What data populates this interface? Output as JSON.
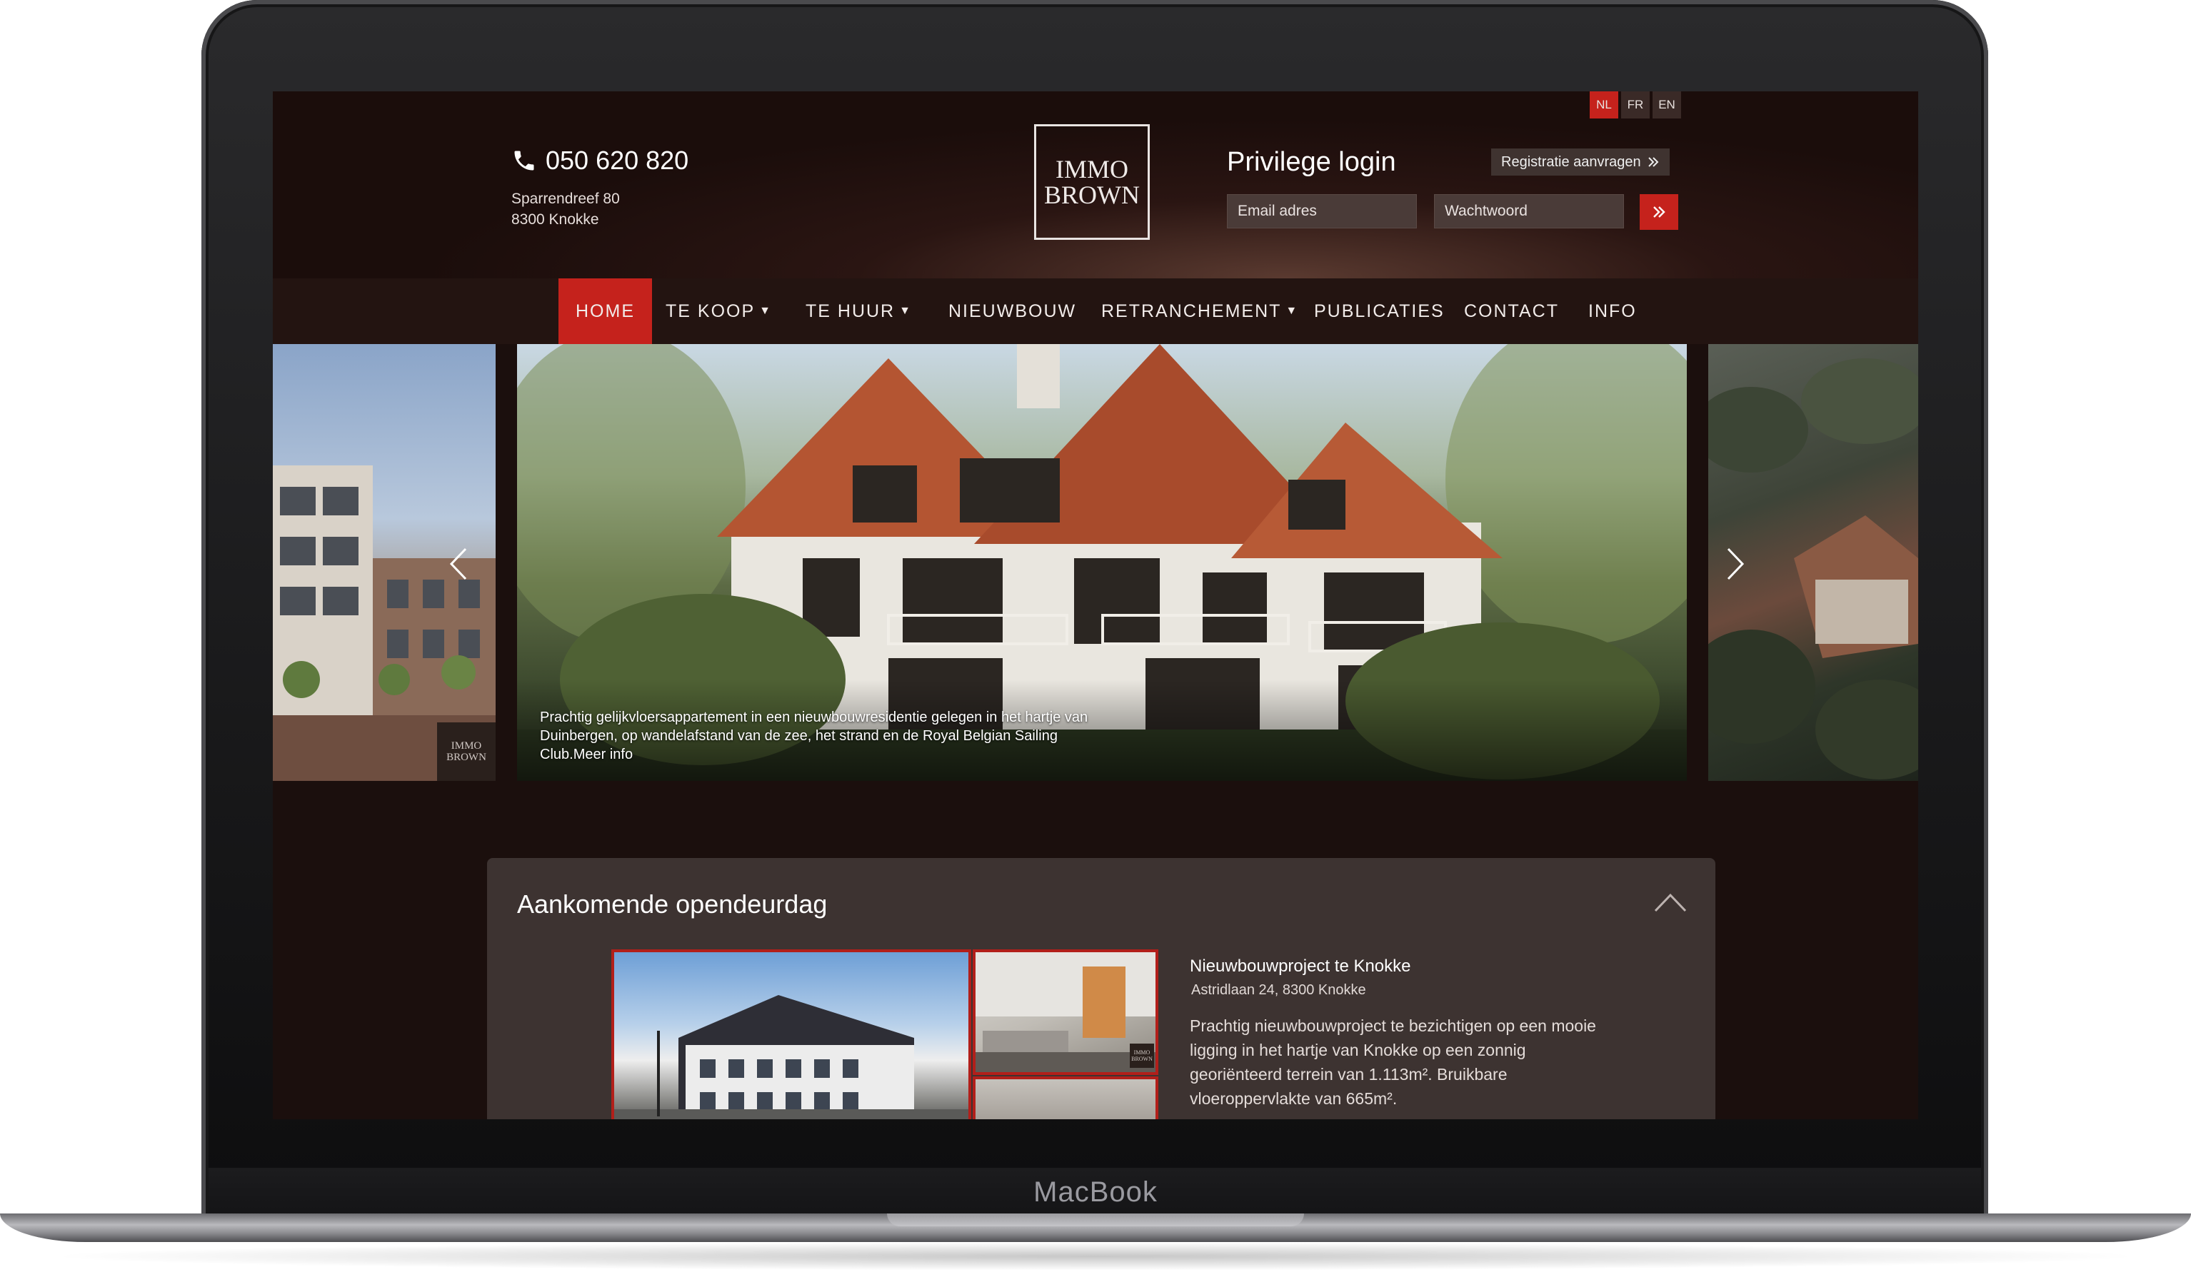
{
  "device": {
    "label": "MacBook"
  },
  "languages": [
    {
      "code": "NL",
      "active": true
    },
    {
      "code": "FR",
      "active": false
    },
    {
      "code": "EN",
      "active": false
    }
  ],
  "contact": {
    "phone": "050 620 820",
    "address_line1": "Sparrendreef 80",
    "address_line2": "8300 Knokke"
  },
  "logo": {
    "line1": "IMMO",
    "line2": "BROWN"
  },
  "login": {
    "title": "Privilege login",
    "register_label": "Registratie aanvragen",
    "email_placeholder": "Email adres",
    "password_placeholder": "Wachtwoord"
  },
  "nav": {
    "items": [
      {
        "label": "HOME",
        "active": true,
        "dropdown": false
      },
      {
        "label": "TE KOOP",
        "active": false,
        "dropdown": true
      },
      {
        "label": "TE HUUR",
        "active": false,
        "dropdown": true
      },
      {
        "label": "NIEUWBOUW",
        "active": false,
        "dropdown": false
      },
      {
        "label": "RETRANCHEMENT",
        "active": false,
        "dropdown": true
      },
      {
        "label": "PUBLICATIES",
        "active": false,
        "dropdown": false
      },
      {
        "label": "CONTACT",
        "active": false,
        "dropdown": false
      },
      {
        "label": "INFO",
        "active": false,
        "dropdown": false
      }
    ]
  },
  "slider": {
    "caption": "Prachtig gelijkvloersappartement in een nieuwbouwresidentie gelegen in het hartje van Duinbergen, op wandelafstand van de zee, het strand en de Royal Belgian Sailing Club.",
    "more_label": "Meer info"
  },
  "open_house": {
    "title": "Aankomende opendeurdag",
    "listing_title": "Nieuwbouwproject te Knokke",
    "listing_address": "Astridlaan 24, 8300 Knokke",
    "listing_description": "Prachtig nieuwbouwproject te bezichtigen op een mooie ligging in het hartje van Knokke op een zonnig georiënteerd terrein van 1.113m². Bruikbare vloeroppervlakte van 665m²."
  },
  "colors": {
    "accent": "#c5221c",
    "header_bg": "#1b0d0b",
    "nav_bg": "#231411",
    "panel_bg": "#3d3331"
  }
}
